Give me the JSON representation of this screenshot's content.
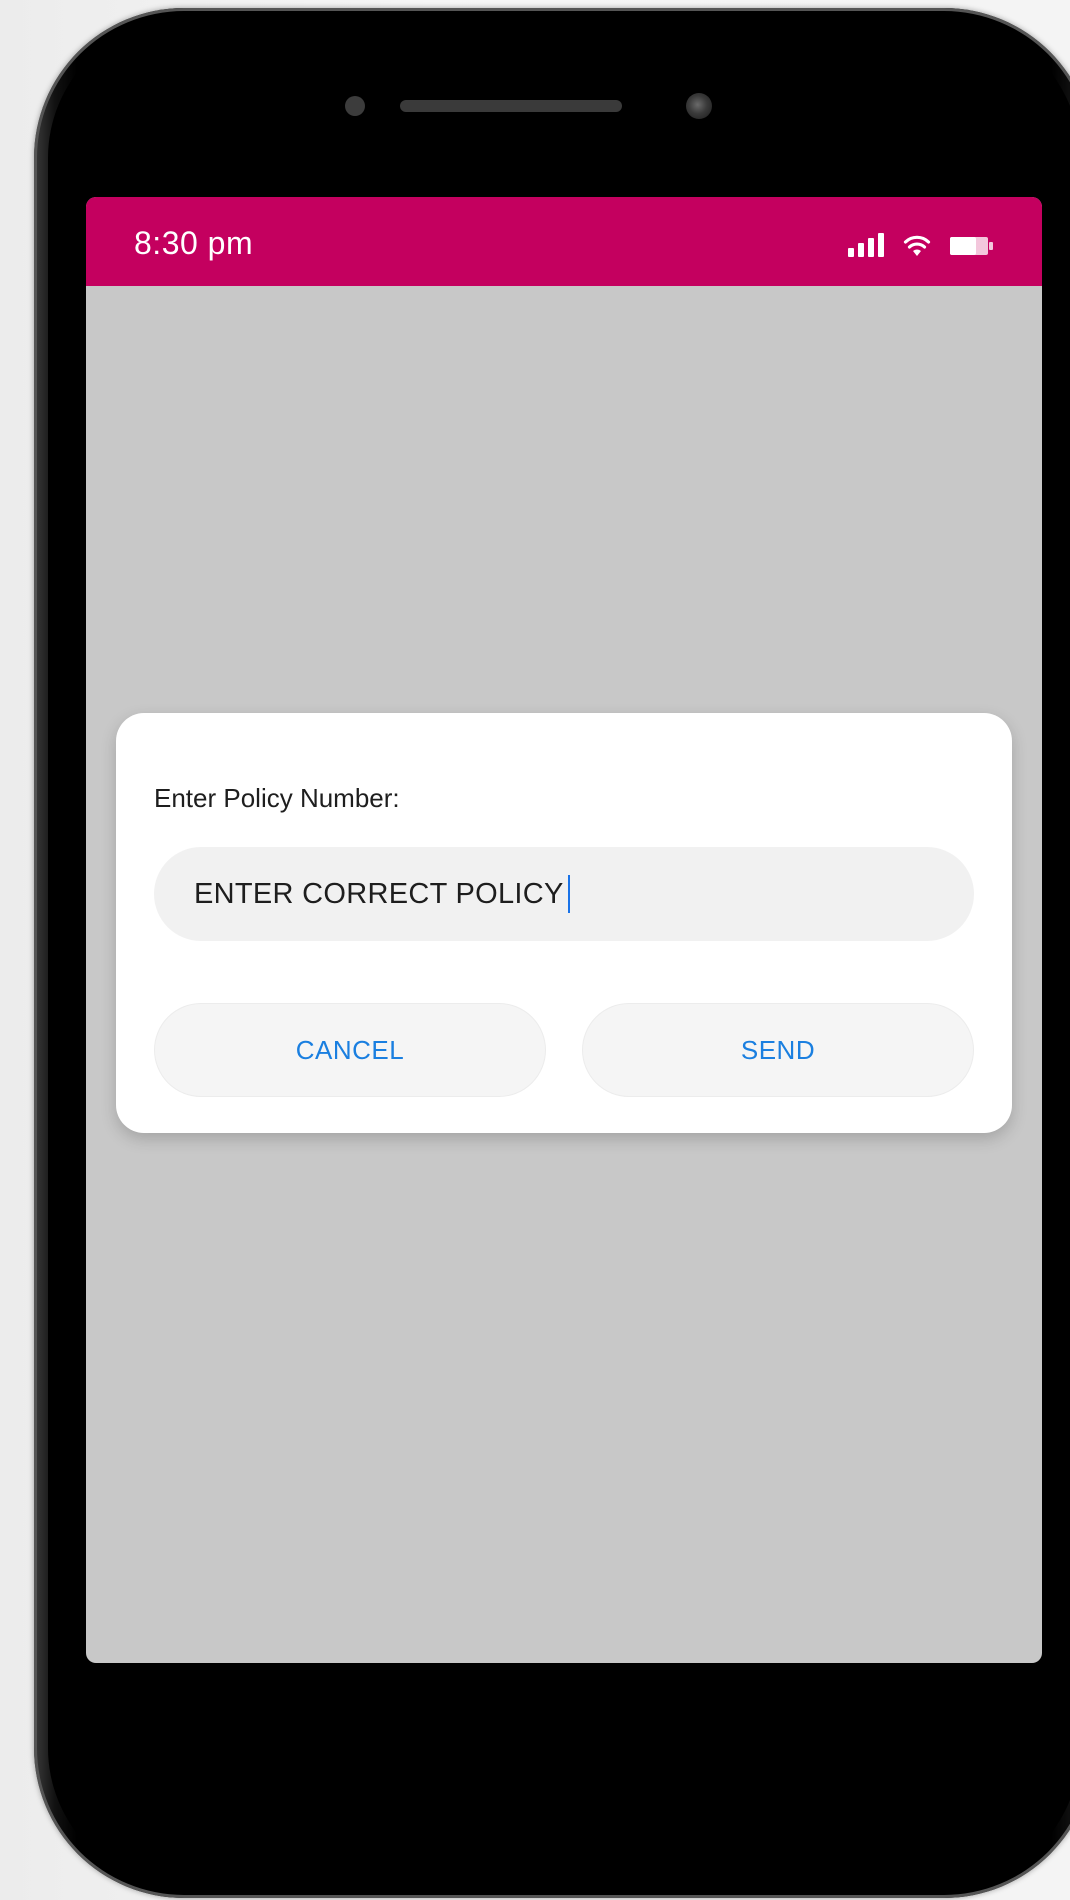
{
  "status_bar": {
    "time": "8:30 pm",
    "icons": [
      "signal-icon",
      "wifi-icon",
      "battery-icon"
    ],
    "background_color": "#c4005f"
  },
  "dialog": {
    "label": "Enter Policy Number:",
    "input_value": "ENTER CORRECT POLICY",
    "cancel_label": "CANCEL",
    "send_label": "SEND",
    "button_text_color": "#1a7fe0"
  },
  "screen": {
    "background_color": "#c8c8c8"
  }
}
